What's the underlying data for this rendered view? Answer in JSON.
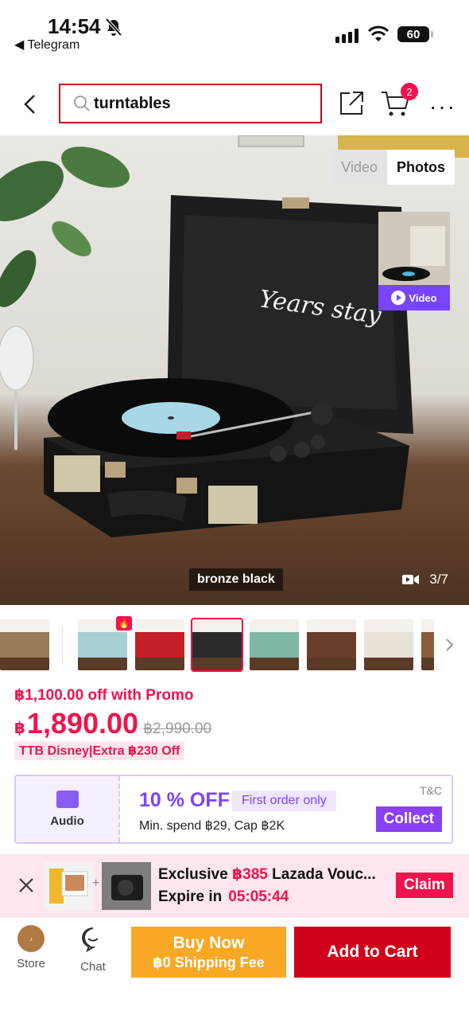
{
  "status_bar": {
    "time": "14:54",
    "back_app": "◀ Telegram",
    "battery": "60"
  },
  "nav": {
    "search_query": "turntables",
    "cart_count": "2"
  },
  "gallery": {
    "tab_video": "Video",
    "tab_photos": "Photos",
    "video_label": "Video",
    "variant_name": "bronze black",
    "counter": "3/7",
    "thumb_colors": [
      "#9a7a58",
      "#a6d0d4",
      "#c42028",
      "#2a2a2a",
      "#7fb7a3",
      "#6a3e2a",
      "#e8e1d6",
      "#8b5b3c"
    ]
  },
  "pricing": {
    "promo": "฿1,100.00 off with Promo",
    "currency": "฿",
    "price": "1,890.00",
    "original_price": "฿2,990.00",
    "tag": "TTB Disney|Extra ฿230 Off"
  },
  "voucher": {
    "category": "Audio",
    "discount": "10 % OFF",
    "badge": "First order only",
    "terms": "Min. spend ฿29, Cap ฿2K",
    "tc": "T&C",
    "collect": "Collect"
  },
  "banner": {
    "line1_prefix": "Exclusive ",
    "line1_amount": "฿385",
    "line1_suffix": " Lazada Vouc...",
    "line2_label": "Expire in",
    "countdown": "05:05:44",
    "claim": "Claim"
  },
  "bottom_bar": {
    "store": "Store",
    "chat": "Chat",
    "buy_now": "Buy Now",
    "shipping": "฿0 Shipping Fee",
    "add_to_cart": "Add to Cart"
  },
  "colors": {
    "brand_pink": "#f0134d",
    "add_to_cart_red": "#d0021b",
    "buy_now_orange": "#f9a825",
    "voucher_purple": "#7a44ff"
  }
}
